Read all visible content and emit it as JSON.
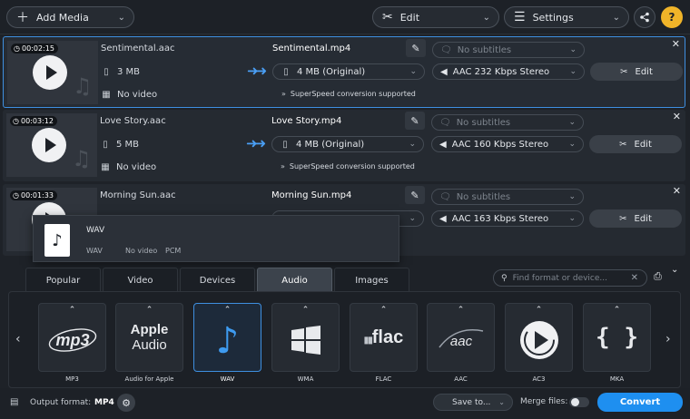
{
  "toolbar": {
    "add_media": {
      "label": "Add Media",
      "icon": "plus-icon"
    },
    "edit": {
      "label": "Edit",
      "icon": "tools-icon"
    },
    "settings": {
      "label": "Settings",
      "icon": "sliders-icon"
    },
    "share_icon": "share-icon",
    "help_label": "?"
  },
  "files": [
    {
      "duration": "00:02:15",
      "source_name": "Sentimental.aac",
      "source_size": "3 MB",
      "source_video": "No video",
      "output_name": "Sentimental.mp4",
      "output_size": "4 MB (Original)",
      "subtitles": "No subtitles",
      "audio": "AAC 232 Kbps Stereo",
      "superspeed": "SuperSpeed conversion supported",
      "edit_label": "Edit",
      "selected": true
    },
    {
      "duration": "00:03:12",
      "source_name": "Love Story.aac",
      "source_size": "5 MB",
      "source_video": "No video",
      "output_name": "Love Story.mp4",
      "output_size": "4 MB (Original)",
      "subtitles": "No subtitles",
      "audio": "AAC 160 Kbps Stereo",
      "superspeed": "SuperSpeed conversion supported",
      "edit_label": "Edit",
      "selected": false
    },
    {
      "duration": "00:01:33",
      "source_name": "Morning Sun.aac",
      "source_size": "",
      "source_video": "",
      "output_name": "Morning Sun.mp4",
      "output_size": "",
      "subtitles": "No subtitles",
      "audio": "AAC 163 Kbps Stereo",
      "superspeed": "",
      "edit_label": "Edit",
      "selected": false
    }
  ],
  "tooltip": {
    "title": "WAV",
    "meta": [
      "WAV",
      "No video",
      "PCM"
    ]
  },
  "tabs": [
    {
      "label": "Popular",
      "active": false
    },
    {
      "label": "Video",
      "active": false
    },
    {
      "label": "Devices",
      "active": false
    },
    {
      "label": "Audio",
      "active": true
    },
    {
      "label": "Images",
      "active": false
    }
  ],
  "search": {
    "placeholder": "Find format or device..."
  },
  "formats": [
    {
      "label": "MP3",
      "logo": "mp3",
      "active": false
    },
    {
      "label": "Audio for Apple",
      "logo_line1": "Apple",
      "logo_line2": "Audio",
      "active": false
    },
    {
      "label": "WAV",
      "logo": "♪",
      "active": true
    },
    {
      "label": "WMA",
      "logo": "windows-logo",
      "active": false
    },
    {
      "label": "FLAC",
      "logo": "flac",
      "active": false
    },
    {
      "label": "AAC",
      "logo": "aac",
      "active": false
    },
    {
      "label": "AC3",
      "logo": "play-disc-logo",
      "active": false
    },
    {
      "label": "MKA",
      "logo": "{ }",
      "active": false
    }
  ],
  "bottom": {
    "output_format_label": "Output format:",
    "output_format_value": "MP4",
    "save_to": "Save to...",
    "merge_label": "Merge files:",
    "merge_on": false,
    "convert_label": "Convert"
  },
  "colors": {
    "accent": "#1e8ff0",
    "selection_border": "#3e8fe0",
    "help": "#f0b429"
  }
}
